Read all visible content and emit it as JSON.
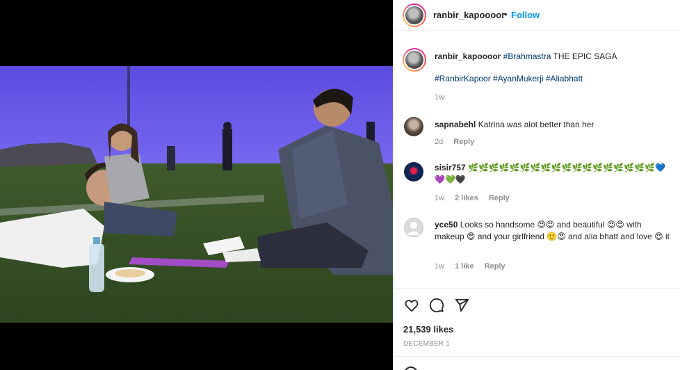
{
  "header": {
    "username": "ranbir_kapoooor",
    "separator": "•",
    "follow_label": "Follow"
  },
  "caption": {
    "username": "ranbir_kapoooor",
    "tag1": "#Brahmastra",
    "text": " THE EPIC SAGA",
    "tags2": "#RanbirKapoor #AyanMukerji #Aliabhatt",
    "time": "1w"
  },
  "comments": [
    {
      "username": "sapnabehl",
      "text": " Katrina was alot better than her",
      "time": "2d",
      "reply_label": "Reply"
    },
    {
      "username": "sisir757",
      "text": " 🌿🌿🌿🌿🌿🌿🌿🌿🌿🌿🌿🌿🌿🌿🌿🌿🌿🌿💙💜💚🖤",
      "time": "1w",
      "likes": "2 likes",
      "reply_label": "Reply"
    },
    {
      "username": "yce50",
      "text": " Looks so handsome 😍😍 and beautiful 😍😍 with makeup 😍 and your girlfriend 🙂😍 and alia bhatt and love 😍 it",
      "time": "1w",
      "likes": "1 like",
      "reply_label": "Reply"
    }
  ],
  "actions": {
    "like_icon": "heart-icon",
    "comment_icon": "comment-icon",
    "share_icon": "share-icon"
  },
  "likes_count": "21,539 likes",
  "post_date": "DECEMBER 1",
  "colors": {
    "link": "#0095f6",
    "hashtag": "#00376b",
    "muted": "#8e8e8e"
  }
}
